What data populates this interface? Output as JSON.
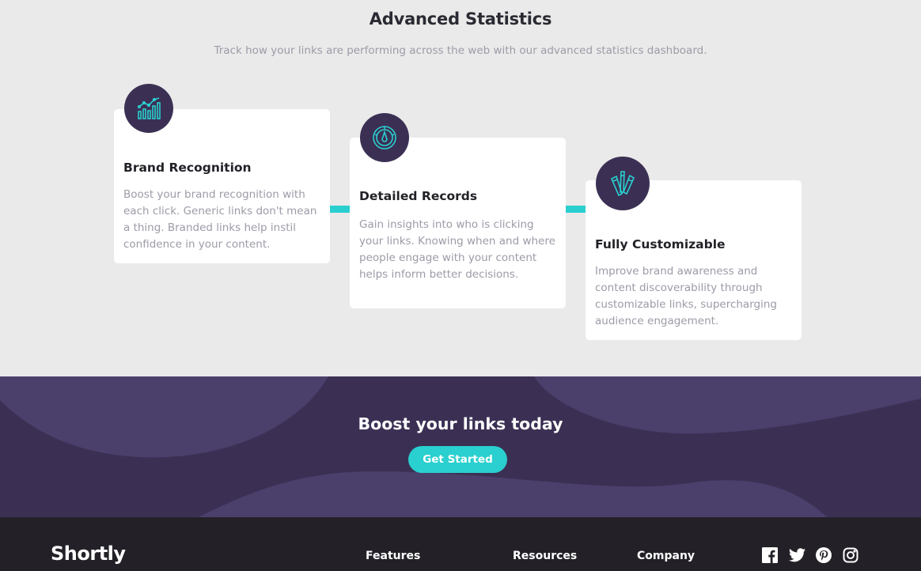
{
  "stats": {
    "title": "Advanced Statistics",
    "subtitle": "Track how your links are performing across the web with our advanced statistics dashboard.",
    "cards": [
      {
        "icon": "chart-icon",
        "title": "Brand Recognition",
        "body": "Boost your brand recognition with each click. Generic links don't mean a thing. Branded links help instil confidence in your content."
      },
      {
        "icon": "gauge-icon",
        "title": "Detailed Records",
        "body": "Gain insights into who is clicking your links. Knowing when and where people engage with your content helps inform better decisions."
      },
      {
        "icon": "pens-icon",
        "title": "Fully Customizable",
        "body": "Improve brand awareness and content discoverability through customizable links, supercharging audience engagement."
      }
    ]
  },
  "boost": {
    "title": "Boost your links today",
    "button_label": "Get Started"
  },
  "footer": {
    "logo": "Shortly",
    "columns": [
      "Features",
      "Resources",
      "Company"
    ],
    "social": [
      "facebook-icon",
      "twitter-icon",
      "pinterest-icon",
      "instagram-icon"
    ]
  },
  "colors": {
    "cyan": "#2acfcf",
    "dark_violet": "#3b3054",
    "very_dark": "#232127",
    "grayish_violet": "#9e9aa7",
    "background": "#eaeaea"
  }
}
